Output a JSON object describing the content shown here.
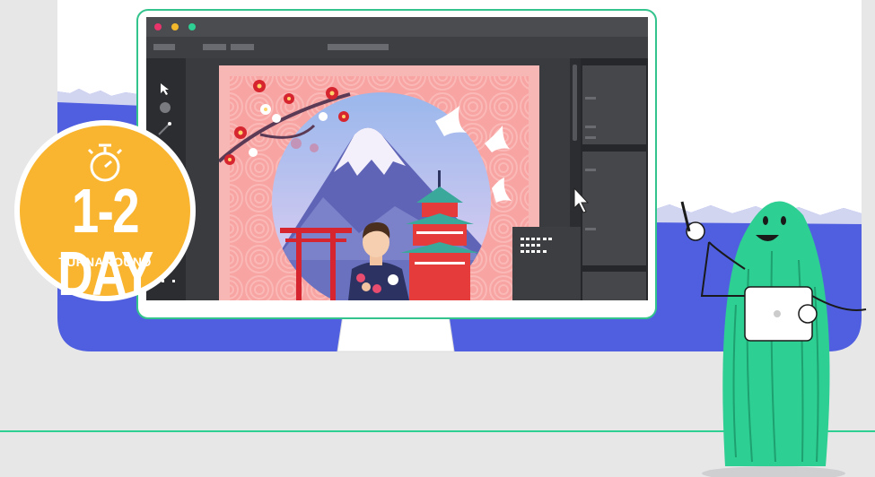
{
  "badge": {
    "title": "1-2 DAY",
    "subtitle": "TURNAROUND",
    "icon": "stopwatch-icon"
  },
  "colors": {
    "background": "#e7e7e8",
    "brand_blue": "#4f5fe0",
    "accent_green": "#2ecf92",
    "badge_yellow": "#f9b530",
    "monitor_border": "#33c38c",
    "window_dots": [
      "#e8336b",
      "#f3b72c",
      "#2ecf92"
    ]
  },
  "editor": {
    "tools": [
      "select-tool-icon",
      "circle-tool-icon",
      "pen-tool-icon"
    ],
    "cursor": "pointer-cursor-icon"
  }
}
